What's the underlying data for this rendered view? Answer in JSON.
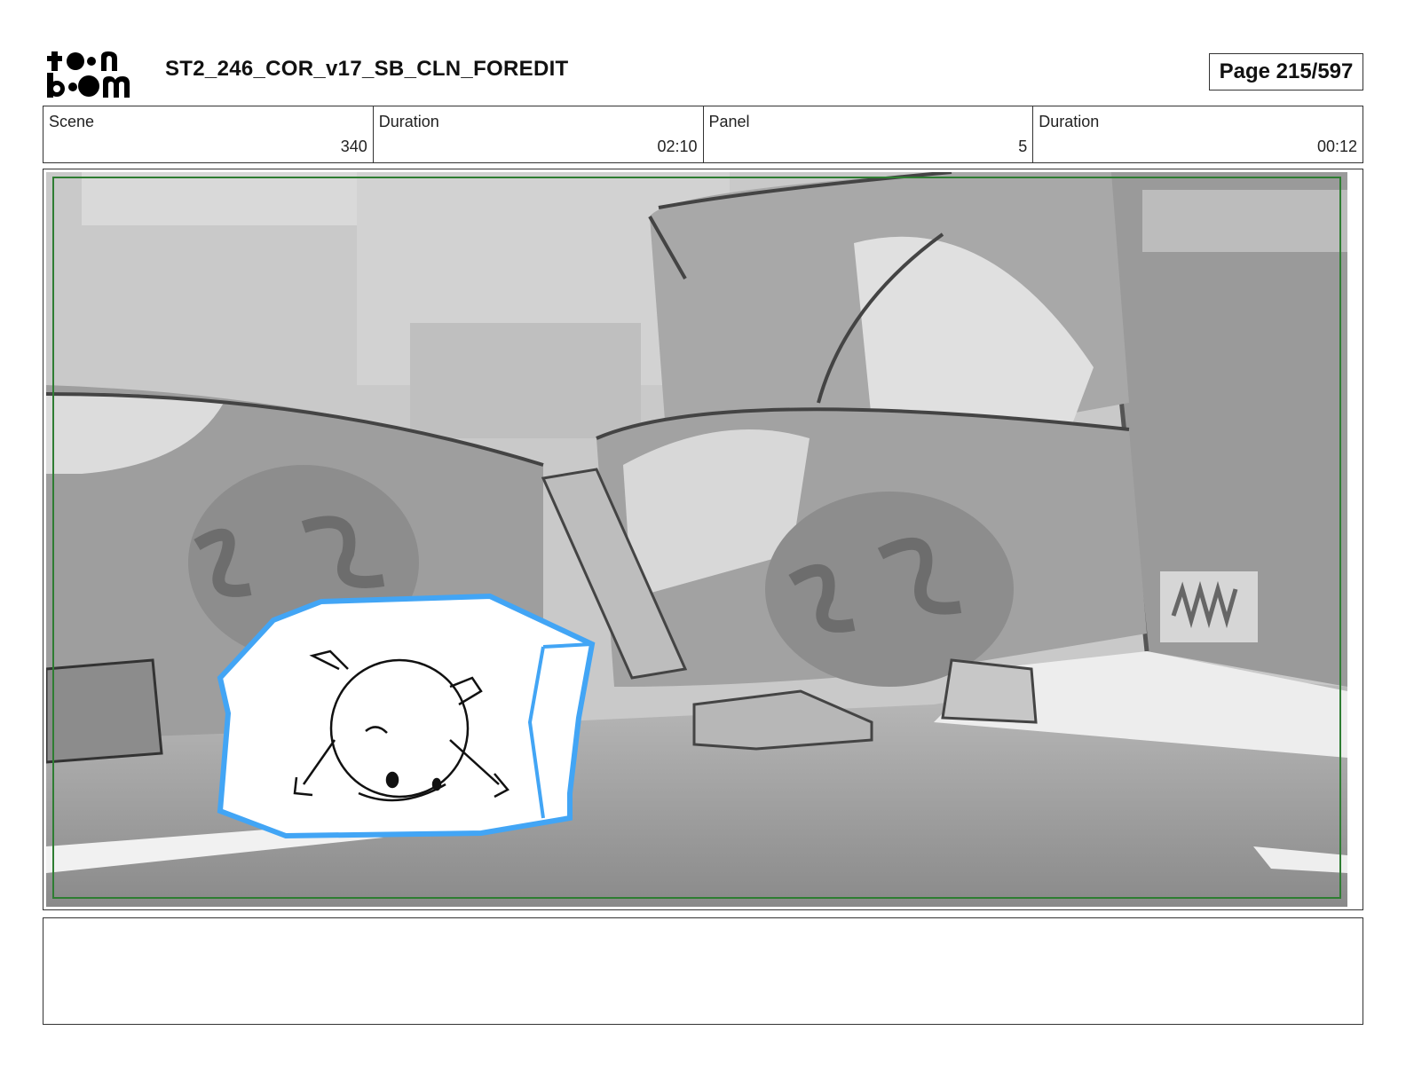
{
  "header": {
    "logo_top": "toon",
    "logo_bottom": "boom",
    "title": "ST2_246_COR_v17_SB_CLN_FOREDIT",
    "page_label": "Page 215/597"
  },
  "info": [
    {
      "label": "Scene",
      "value": "340"
    },
    {
      "label": "Duration",
      "value": "02:10"
    },
    {
      "label": "Panel",
      "value": "5"
    },
    {
      "label": "Duration",
      "value": "00:12"
    }
  ],
  "panel": {
    "safe_frame_color": "#2e7d32",
    "ice_outline_color": "#42a5f5"
  },
  "notes": {
    "text": ""
  }
}
